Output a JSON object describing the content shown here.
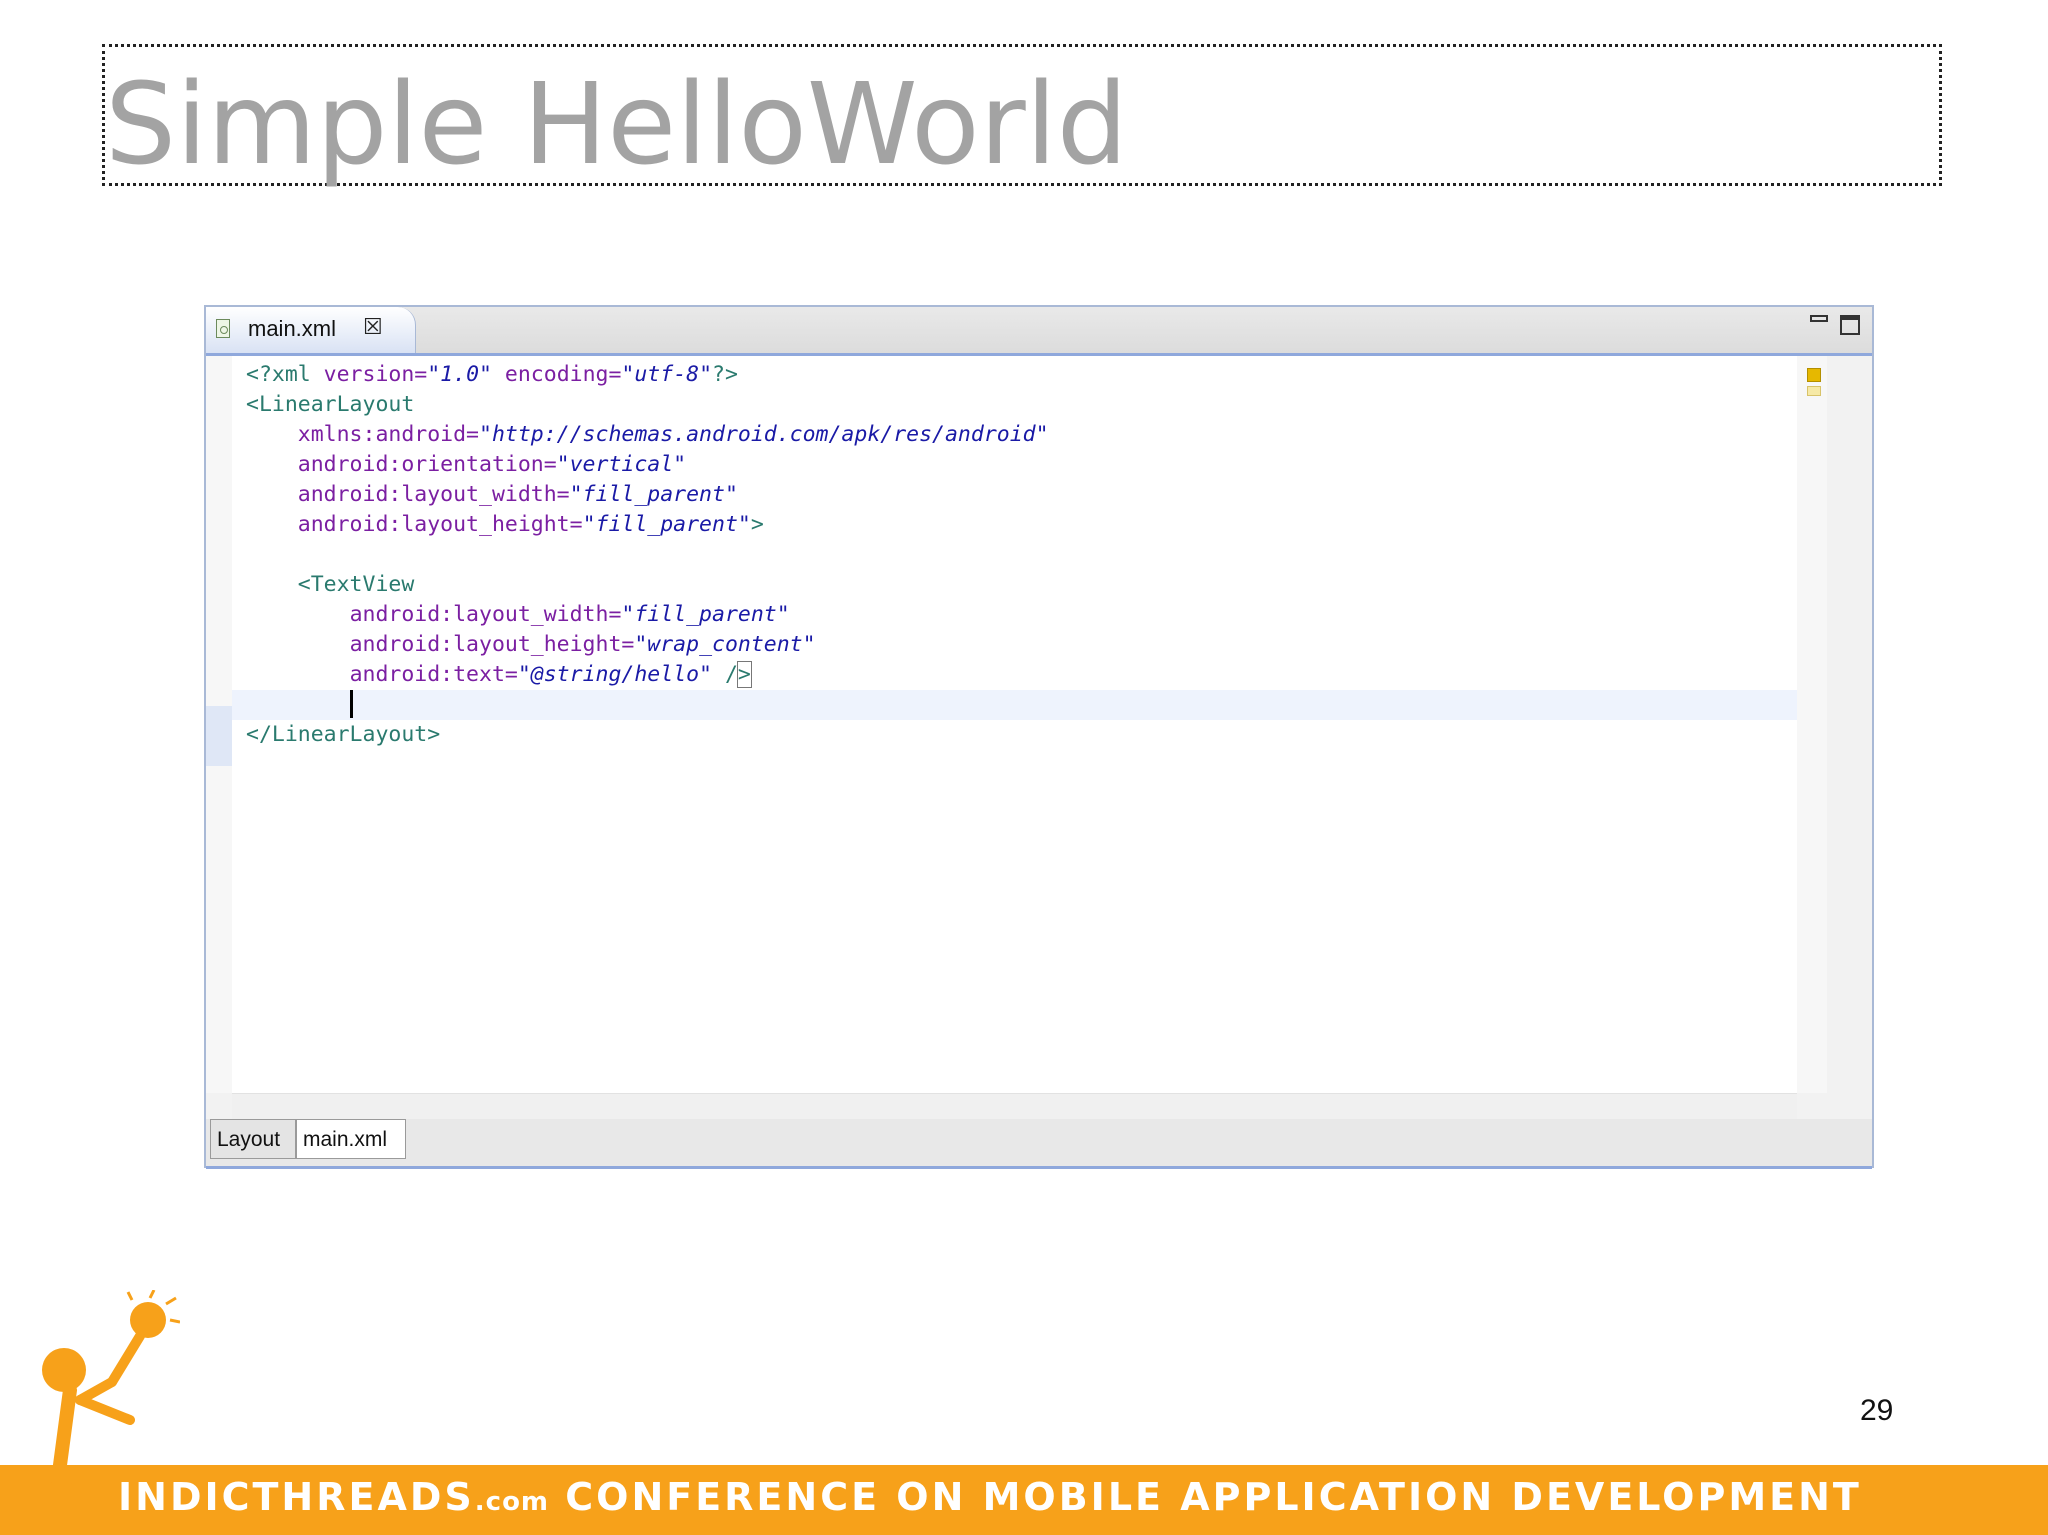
{
  "slide": {
    "title": "Simple HelloWorld",
    "page_number": "29"
  },
  "editor": {
    "tab_label": "main.xml",
    "bottom_tabs": [
      "Layout",
      "main.xml"
    ],
    "code": {
      "l1": {
        "open": "<?xml ",
        "a1": "version=",
        "v1": "\"1.0\"",
        "a2": " encoding=",
        "v2": "\"utf-8\"",
        "close": "?>"
      },
      "l2": {
        "tag": "<LinearLayout"
      },
      "l3": {
        "attr": "xmlns:android=",
        "val": "\"http://schemas.android.com/apk/res/android\""
      },
      "l4": {
        "attr": "android:orientation=",
        "val": "\"vertical\""
      },
      "l5": {
        "attr": "android:layout_width=",
        "val": "\"fill_parent\""
      },
      "l6": {
        "attr": "android:layout_height=",
        "val": "\"fill_parent\"",
        "close": ">"
      },
      "l8": {
        "tag": "<TextView"
      },
      "l9": {
        "attr": "android:layout_width=",
        "val": "\"fill_parent\""
      },
      "l10": {
        "attr": "android:layout_height=",
        "val": "\"wrap_content\""
      },
      "l11": {
        "attr": "android:text=",
        "val": "\"@string/hello\"",
        "close_slash": " /",
        "close_gt": ">"
      },
      "l13": {
        "tag": "</LinearLayout>"
      }
    }
  },
  "footer": {
    "brand": "IndicThreads",
    "brand_suffix": ".com",
    "tagline": " Conference on Mobile Application Development"
  },
  "colors": {
    "footer_band": "#f7a11a",
    "title_text": "#a3a3a3",
    "xml_tag": "#2a7a6e",
    "xml_attr": "#7b1fa2",
    "xml_value": "#1a1aa6"
  },
  "icons": {
    "tab_file": "xml-file-icon",
    "tab_close": "close-icon",
    "minimize": "minimize-icon",
    "maximize": "maximize-icon",
    "mascot": "lightbulb-stick-figure-logo"
  }
}
